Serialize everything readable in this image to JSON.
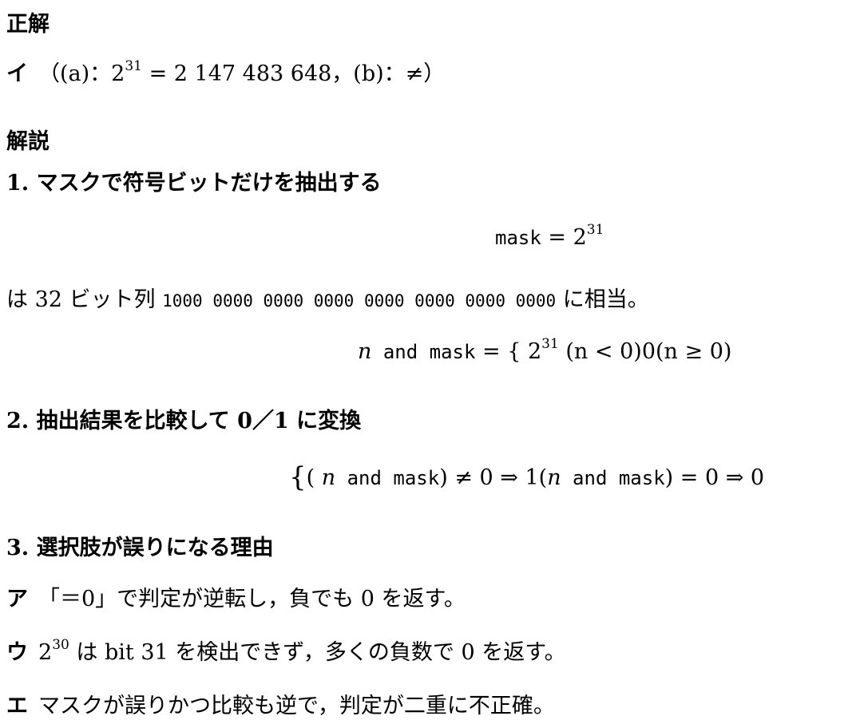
{
  "answer": {
    "heading": "正解",
    "label": "イ",
    "open": "（(a)：2",
    "exp": "31",
    "eq": " = 2 147 483 648，(b)：≠）"
  },
  "explanation": {
    "heading": "解説",
    "step1": {
      "title": "1. マスクで符号ビットだけを抽出する",
      "mask_name": "mask",
      "mask_eq": " = 2",
      "mask_exp": "31",
      "note_prefix": "は 32 ビット列 ",
      "bits": "1000 0000 0000 0000 0000 0000 0000 0000",
      "note_suffix": " に相当。",
      "n": "n",
      "and_mask": " and mask",
      "eq_brace": " = {",
      "val2": " 2",
      "val_exp": "31",
      "cond1": " (n < 0)0(n ≥ 0)"
    },
    "step2": {
      "title": "2. 抽出結果を比較して 0／1 に変換",
      "brace": "{",
      "part1a": "( ",
      "n1": "n",
      "and1": "  and mask",
      "part1b": ") ≠ 0 ⇒ 1(",
      "n2": "n",
      "and2": "  and mask",
      "part2b": ") = 0 ⇒ 0"
    },
    "step3": {
      "title": "3. 選択肢が誤りになる理由",
      "items": [
        {
          "label": "ア",
          "text": "「＝0」で判定が逆転し，負でも 0 を返す。"
        },
        {
          "label": "ウ",
          "pre": "2",
          "exp": "30",
          "text": " は bit 31 を検出できず，多くの負数で 0 を返す。"
        },
        {
          "label": "エ",
          "text": "マスクが誤りかつ比較も逆で，判定が二重に不正確。"
        }
      ]
    }
  }
}
